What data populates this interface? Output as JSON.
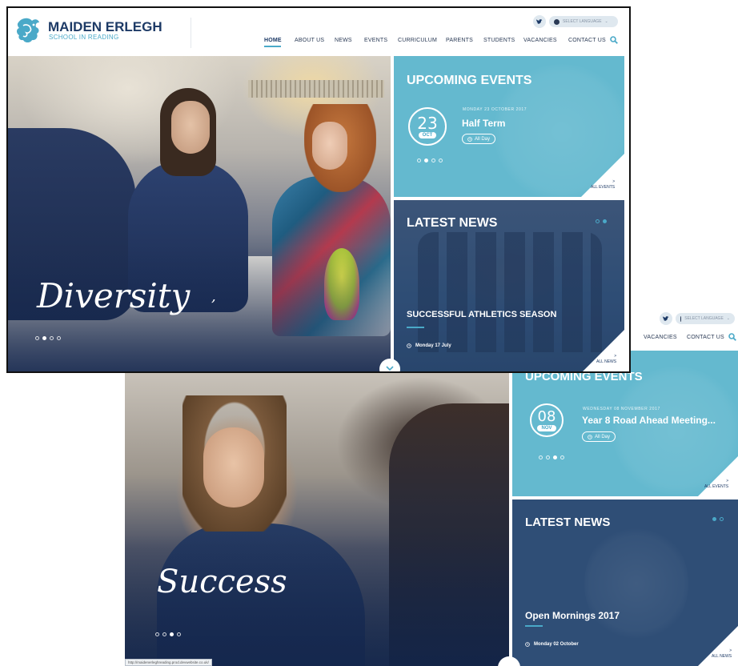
{
  "colors": {
    "navy": "#1d3a66",
    "teal": "#4aa9c8",
    "events_bg": "#64b9cf",
    "news_bg": "#2f4e76"
  },
  "screenshot_top": {
    "brand": {
      "name": "MAIDEN ERLEGH",
      "tagline": "SCHOOL IN READING",
      "logo_icon": "dragon-logo-icon"
    },
    "language_label": "SELECT LANGUAGE",
    "nav": [
      "HOME",
      "ABOUT US",
      "NEWS",
      "EVENTS",
      "CURRICULUM",
      "PARENTS",
      "STUDENTS",
      "VACANCIES",
      "CONTACT US"
    ],
    "active_nav": "HOME",
    "hero_word": "Diversity",
    "hero_extra": ",",
    "hero_dots": 4,
    "hero_active_dot": 1,
    "events": {
      "title": "UPCOMING EVENTS",
      "day": "23",
      "month": "OCT",
      "date_line": "MONDAY 23 OCTOBER 2017",
      "name": "Half Term",
      "time": "All Day",
      "dots": 4,
      "active_dot": 1,
      "link_arrow": ">",
      "link": "ALL EVENTS"
    },
    "news": {
      "title": "LATEST NEWS",
      "headline": "SUCCESSFUL ATHLETICS SEASON",
      "date": "Monday 17 July",
      "dots": 2,
      "active_dot": 1,
      "link_arrow": ">",
      "link": "ALL NEWS"
    }
  },
  "screenshot_bottom": {
    "language_label": "SELECT LANGUAGE",
    "nav": [
      "VACANCIES",
      "CONTACT US"
    ],
    "hero_word": "Success",
    "hero_dots": 4,
    "hero_active_dot": 2,
    "status_url": "http://maidenerleghreading.prod.devwebsite.co.uk/",
    "events": {
      "title": "UPCOMING EVENTS",
      "day": "08",
      "month": "NOV",
      "date_line": "WEDNESDAY 08 NOVEMBER 2017",
      "name": "Year 8 Road Ahead Meeting...",
      "time": "All Day",
      "dots": 4,
      "active_dot": 2,
      "link_arrow": ">",
      "link": "ALL EVENTS"
    },
    "news": {
      "title": "LATEST NEWS",
      "headline": "Open Mornings 2017",
      "date": "Monday 02 October",
      "dots": 2,
      "active_dot": 0,
      "link_arrow": ">",
      "link": "ALL NEWS"
    }
  }
}
